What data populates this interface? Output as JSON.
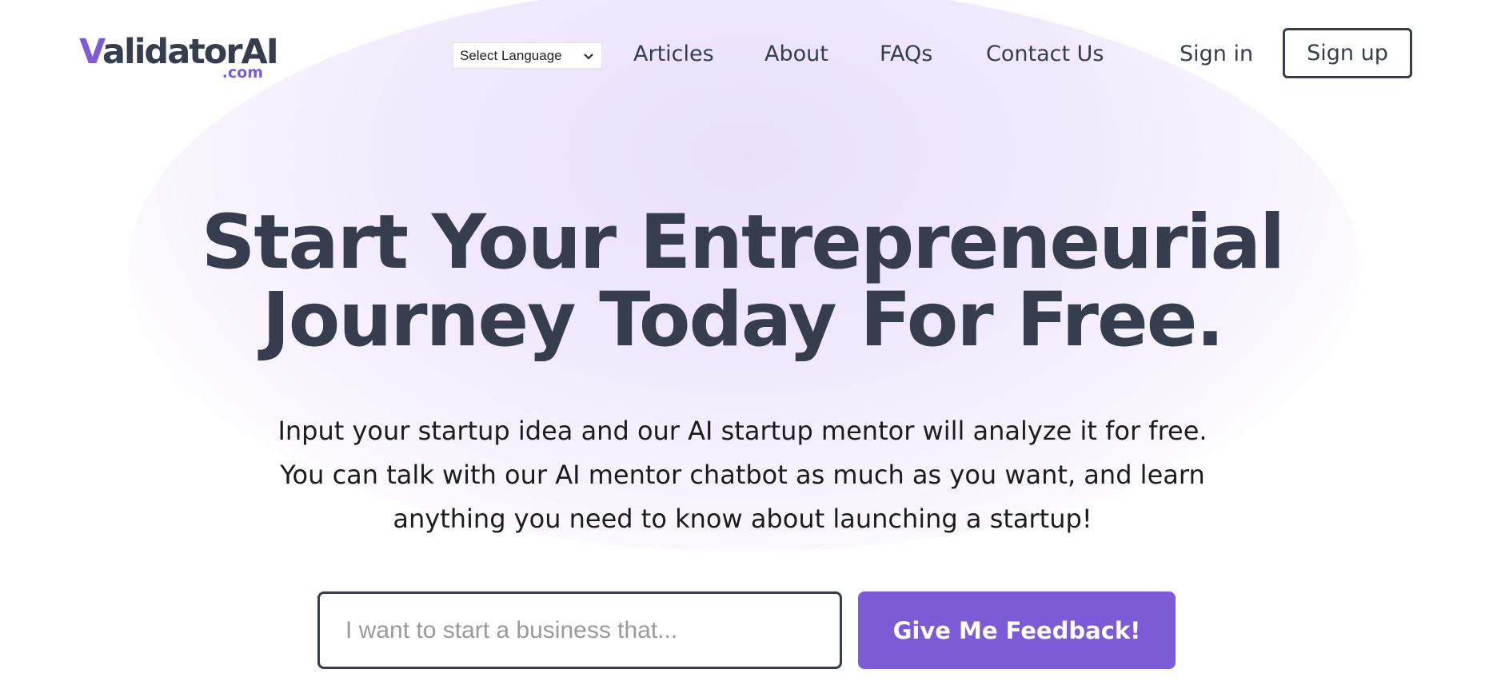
{
  "colors": {
    "accent": "#7c5cd6",
    "text_dark": "#353d4f",
    "hero_glow": "#ece3fb"
  },
  "header": {
    "logo": {
      "first_letter": "V",
      "rest": "alidatorAI",
      "suffix": ".com"
    },
    "language_select": {
      "selected": "Select Language",
      "icon": "chevron-down-icon"
    },
    "nav": {
      "articles": "Articles",
      "about": "About",
      "faqs": "FAQs",
      "contact": "Contact Us"
    },
    "sign_in": "Sign in",
    "sign_up": "Sign up"
  },
  "hero": {
    "title_line1": "Start Your Entrepreneurial",
    "title_line2": "Journey Today For Free.",
    "subtitle_line1": "Input your startup idea and our AI startup mentor will analyze it for free.",
    "subtitle_line2": "You can talk with our AI mentor chatbot as much as you want, and learn",
    "subtitle_line3": "anything you need to know about launching a startup!"
  },
  "form": {
    "idea_placeholder": "I want to start a business that...",
    "idea_value": "",
    "submit_label": "Give Me Feedback!"
  }
}
